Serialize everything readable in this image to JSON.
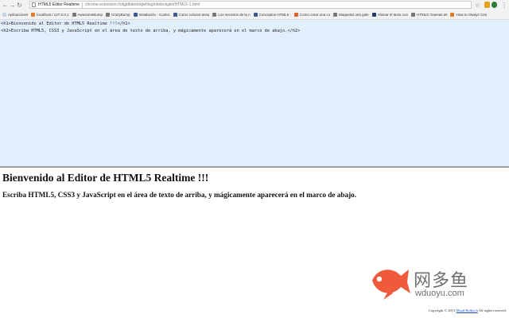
{
  "browser": {
    "tab_title": "HTML5 Editor Realtime",
    "url": "chrome-extension://ofgjdbdedckjlehfagmbnbckgkh/HTML5-1.html"
  },
  "bookmarks": [
    {
      "label": "Aplicaciones",
      "color": "#4a78c0"
    },
    {
      "label": "localhost / 127.0.0.1",
      "color": "#e07b25"
    },
    {
      "label": "AwesomeBump",
      "color": "#777777"
    },
    {
      "label": "CrazyBump",
      "color": "#777777"
    },
    {
      "label": "Instalación - Contro",
      "color": "#3b5a8f"
    },
    {
      "label": "Como colocar texto",
      "color": "#3b5a8f"
    },
    {
      "label": "Los secretos de la n",
      "color": "#777777"
    },
    {
      "label": "Conceptos HTML5 -",
      "color": "#3b5a8f"
    },
    {
      "label": "Como crear una co",
      "color": "#e0622a"
    },
    {
      "label": "Maquetar una gale",
      "color": "#777777"
    },
    {
      "label": "Alinear el texto con",
      "color": "#1f3d6b"
    },
    {
      "label": "HTML5: Nuevas eti",
      "color": "#777777"
    },
    {
      "label": "How to Always Cen",
      "color": "#e07b25"
    }
  ],
  "editor": {
    "line1": "<h1>Bienvenido al Editor de HTML5 Realtime !!!</h1>",
    "line2": "<h2>Escriba HTML5, CSS3 y JavaScript en el área de texto de arriba, y mágicamente aparecerá en el marco de abajo.</h2>"
  },
  "preview": {
    "h1": "Bienvenido al Editor de HTML5 Realtime !!!",
    "h2": "Escriba HTML5, CSS3 y JavaScript en el área de texto de arriba, y mágicamente aparecerá en el marco de abajo."
  },
  "watermark": {
    "brand": "网多鱼",
    "domain": "wduoyu.com"
  },
  "footer": {
    "prefix": "Copyright © 2013",
    "link": "Moad Belkoch",
    "suffix": "All rights reserved."
  },
  "colors": {
    "editor_bg": "#e1eefc",
    "fish": "#ef5a3c"
  }
}
